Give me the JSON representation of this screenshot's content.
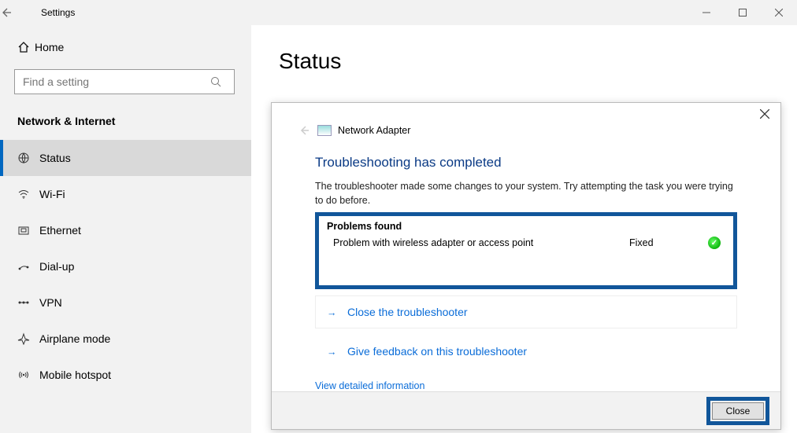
{
  "window": {
    "title": "Settings"
  },
  "sidebar": {
    "home_label": "Home",
    "search_placeholder": "Find a setting",
    "category": "Network & Internet",
    "items": [
      {
        "label": "Status",
        "selected": true
      },
      {
        "label": "Wi-Fi"
      },
      {
        "label": "Ethernet"
      },
      {
        "label": "Dial-up"
      },
      {
        "label": "VPN"
      },
      {
        "label": "Airplane mode"
      },
      {
        "label": "Mobile hotspot"
      }
    ]
  },
  "page": {
    "title": "Status"
  },
  "dialog": {
    "breadcrumb": "Network Adapter",
    "title": "Troubleshooting has completed",
    "description": "The troubleshooter made some changes to your system. Try attempting the task you were trying to do before.",
    "problems_header": "Problems found",
    "problems": [
      {
        "text": "Problem with wireless adapter or access point",
        "status": "Fixed"
      }
    ],
    "action_close": "Close the troubleshooter",
    "action_feedback": "Give feedback on this troubleshooter",
    "view_detailed": "View detailed information",
    "close_button": "Close"
  }
}
